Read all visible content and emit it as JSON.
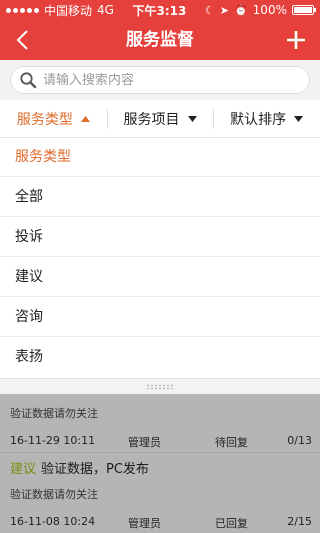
{
  "status_bar": {
    "carrier": "中国移动",
    "network": "4G",
    "time": "下午3:13",
    "battery": "100%",
    "battery_level": 1.0
  },
  "nav": {
    "title": "服务监督",
    "back_icon": "chevron-left-icon",
    "add_icon": "plus-icon"
  },
  "search": {
    "placeholder": "请输入搜索内容",
    "value": ""
  },
  "filters": {
    "tabs": [
      {
        "label": "服务类型",
        "active": true,
        "arrow": "up"
      },
      {
        "label": "服务项目",
        "active": false,
        "arrow": "down"
      },
      {
        "label": "默认排序",
        "active": false,
        "arrow": "down"
      }
    ]
  },
  "dropdown": {
    "header": "服务类型",
    "items": [
      "全部",
      "投诉",
      "建议",
      "咨询",
      "表扬"
    ]
  },
  "list": {
    "items": [
      {
        "tag": "",
        "title": "",
        "desc": "验证数据请勿关注",
        "date": "16-11-29 10:11",
        "author": "管理员",
        "status": "待回复",
        "count": "0/13"
      },
      {
        "tag": "建议",
        "title": "验证数据，PC发布",
        "desc": "验证数据请勿关注",
        "date": "16-11-08 10:24",
        "author": "管理员",
        "status": "已回复",
        "count": "2/15"
      }
    ]
  },
  "colors": {
    "brand": "#e5403b",
    "active_tab": "#e06a2a",
    "tag": "#7d8c0f",
    "overlay": "#b5b5b5"
  }
}
